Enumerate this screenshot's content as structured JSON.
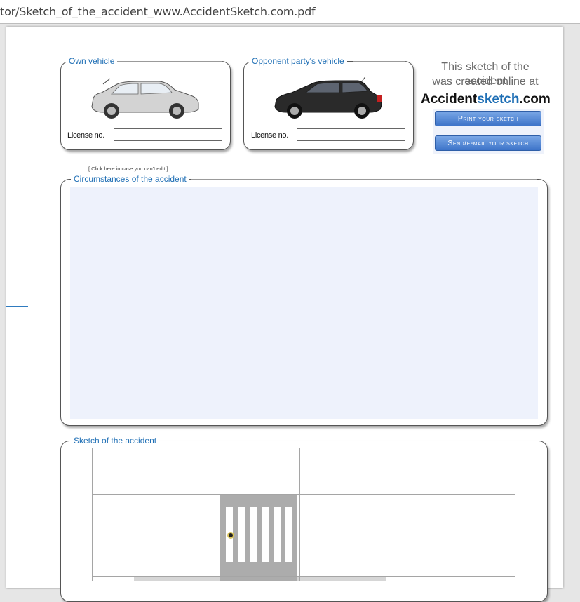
{
  "browser": {
    "url_text": "tor/Sketch_of_the_accident_www.AccidentSketch.com.pdf"
  },
  "own_vehicle": {
    "title": "Own vehicle",
    "license_label": "License no.",
    "license_value": "",
    "car_color": "#cfcfcf"
  },
  "opponent_vehicle": {
    "title": "Opponent party's vehicle",
    "license_label": "License no.",
    "license_value": "",
    "car_color": "#2a2a2a"
  },
  "promo": {
    "line1": "This sketch of the accident",
    "line2": "was created online at",
    "brand_part1": "Accident",
    "brand_part2": "sketch",
    "brand_part3": ".com",
    "print_button": "Print your sketch",
    "send_button": "Send/e-mail your sketch"
  },
  "circumstances": {
    "click_note": "[ Click here in case you can't edit ]",
    "title": "Circumstances of the accident",
    "text": ""
  },
  "sketch": {
    "title": "Sketch of the accident"
  },
  "colors": {
    "accent": "#1f6fb5",
    "button": "#3d74c9",
    "lined_area": "#eef2fc"
  }
}
